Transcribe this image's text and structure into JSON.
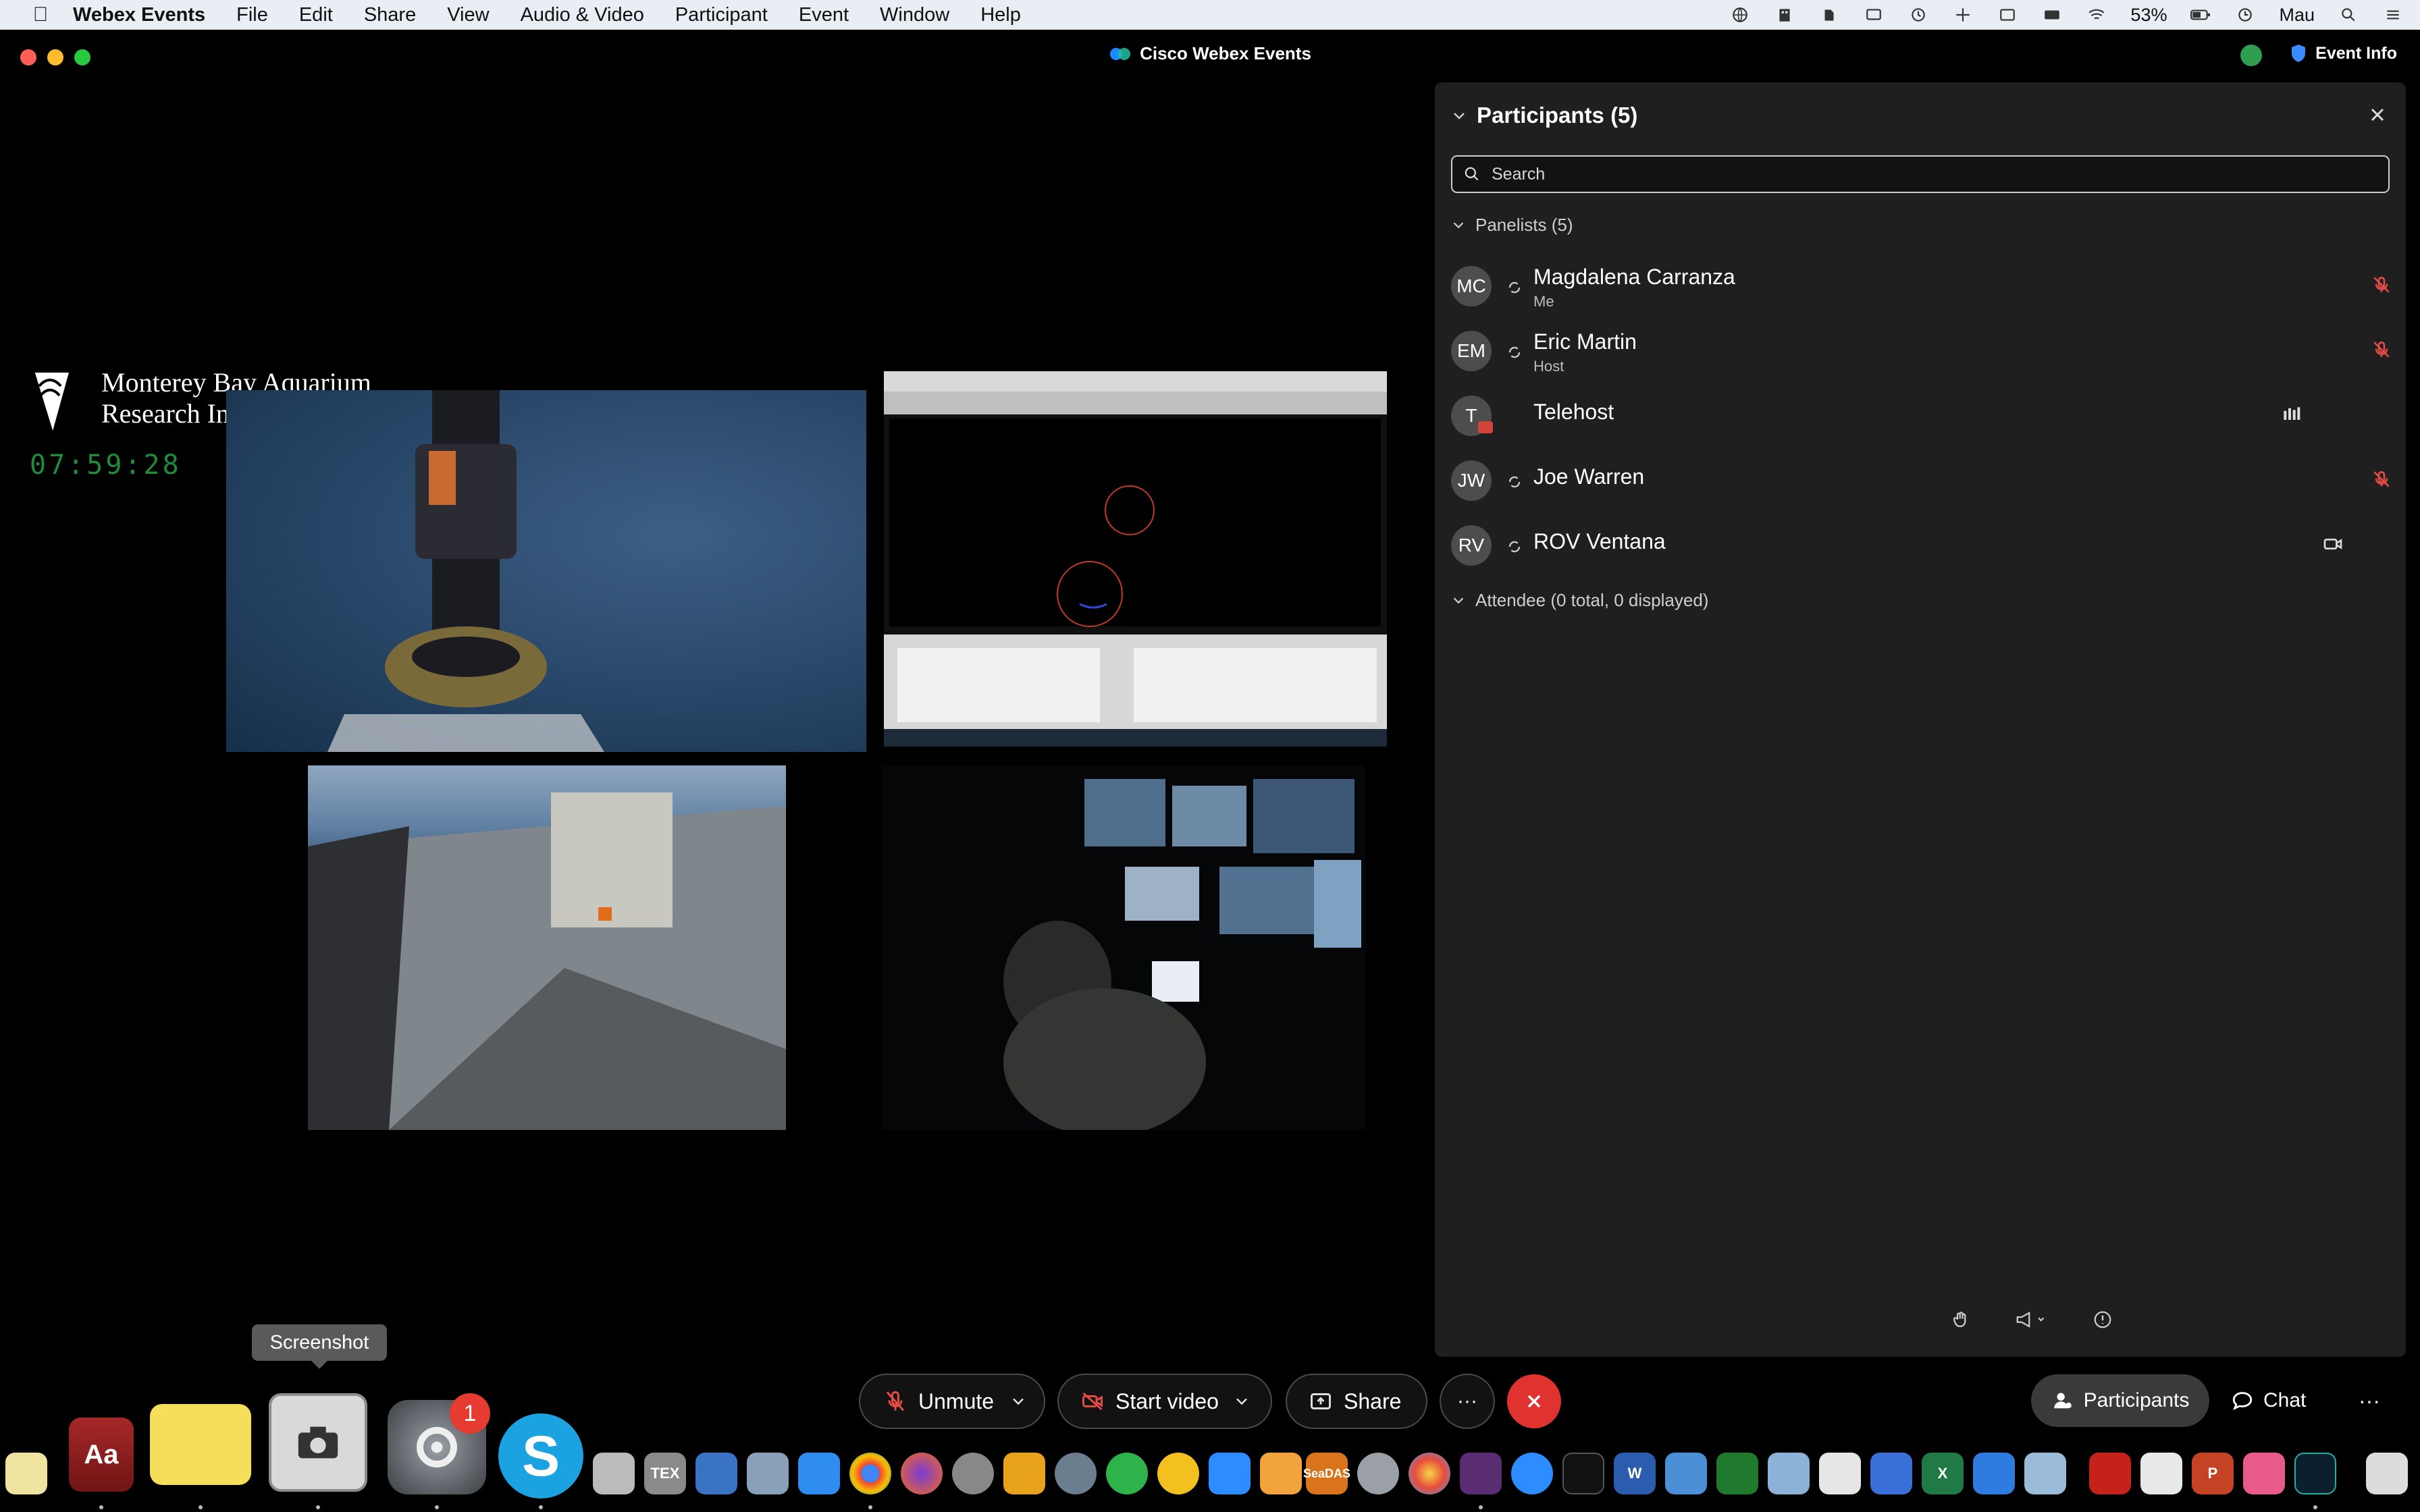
{
  "menubar": {
    "app_name": "Webex Events",
    "items": [
      "File",
      "Edit",
      "Share",
      "View",
      "Audio & Video",
      "Participant",
      "Event",
      "Window",
      "Help"
    ],
    "battery": "53%",
    "user": "Mau"
  },
  "window": {
    "title": "Cisco Webex Events",
    "event_info": "Event Info"
  },
  "stage": {
    "org_line1": "Monterey Bay Aquarium",
    "org_line2": "Research Institute",
    "clock": "07:59:28"
  },
  "panel": {
    "title": "Participants (5)",
    "search_placeholder": "Search",
    "panelists_header": "Panelists (5)",
    "attendee_header": "Attendee (0 total, 0 displayed)",
    "participants": [
      {
        "initials": "MC",
        "name": "Magdalena Carranza",
        "role": "Me",
        "status": "muted"
      },
      {
        "initials": "EM",
        "name": "Eric Martin",
        "role": "Host",
        "status": "muted"
      },
      {
        "initials": "T",
        "name": "Telehost",
        "role": "",
        "status": "speaking"
      },
      {
        "initials": "JW",
        "name": "Joe Warren",
        "role": "",
        "status": "muted"
      },
      {
        "initials": "RV",
        "name": "ROV Ventana",
        "role": "",
        "status": "video"
      }
    ]
  },
  "controls": {
    "unmute": "Unmute",
    "start_video": "Start video",
    "share": "Share",
    "more": "···",
    "participants": "Participants",
    "chat": "Chat",
    "overflow": "···"
  },
  "tooltip": "Screenshot",
  "dock": {
    "badge": "1",
    "labels": [
      "Aa",
      "TEX",
      "SeaDAS",
      "W",
      "X",
      "P"
    ]
  },
  "colors": {
    "accent_leave": "#e0322e",
    "panel_bg": "#1f1f1f",
    "clock_green": "#1f8a3a"
  }
}
